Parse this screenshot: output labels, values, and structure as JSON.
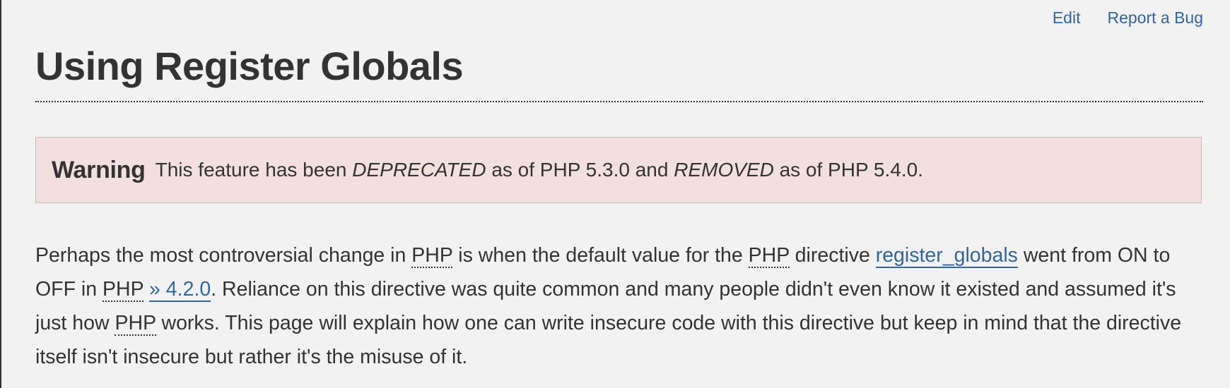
{
  "header": {
    "links": {
      "edit": "Edit",
      "report_bug": "Report a Bug"
    },
    "title": "Using Register Globals"
  },
  "warning": {
    "label": "Warning",
    "text_before": "This feature has been ",
    "deprecated": "DEPRECATED",
    "text_middle": " as of PHP 5.3.0 and ",
    "removed": "REMOVED",
    "text_after": " as of PHP 5.4.0."
  },
  "paragraph": {
    "t1": "Perhaps the most controversial change in ",
    "abbr1": "PHP",
    "t2": " is when the default value for the ",
    "abbr2": "PHP",
    "t3": " directive ",
    "link_register_globals": "register_globals",
    "t4": " went from ON to OFF in ",
    "abbr3": "PHP",
    "t5": " ",
    "link_version": "» 4.2.0",
    "t6": ". Reliance on this directive was quite common and many people didn't even know it existed and assumed it's just how ",
    "abbr4": "PHP",
    "t7": " works. This page will explain how one can write insecure code with this directive but keep in mind that the directive itself isn't insecure but rather it's the misuse of it."
  },
  "colors": {
    "background": "#f2f2f2",
    "text": "#333333",
    "link": "#336699",
    "warning_bg": "#f4dfdf",
    "warning_border": "#cfb9b9"
  }
}
